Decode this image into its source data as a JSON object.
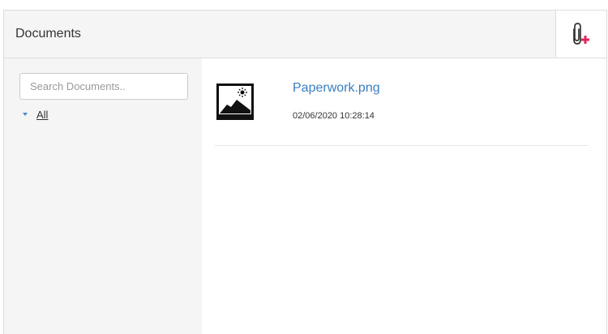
{
  "header": {
    "title": "Documents",
    "attach_icon": "paperclip-plus-icon",
    "attach_plus_color": "#e4245b"
  },
  "sidebar": {
    "search": {
      "placeholder": "Search Documents..",
      "value": ""
    },
    "tree": {
      "all_label": "All",
      "caret_icon": "caret-down-icon"
    }
  },
  "documents": [
    {
      "name": "Paperwork.png",
      "date": "02/06/2020 10:28:14",
      "icon": "image-file-icon"
    }
  ],
  "colors": {
    "link": "#3a7fc1",
    "header_bg": "#f5f5f5",
    "sidebar_bg": "#f5f5f5"
  }
}
